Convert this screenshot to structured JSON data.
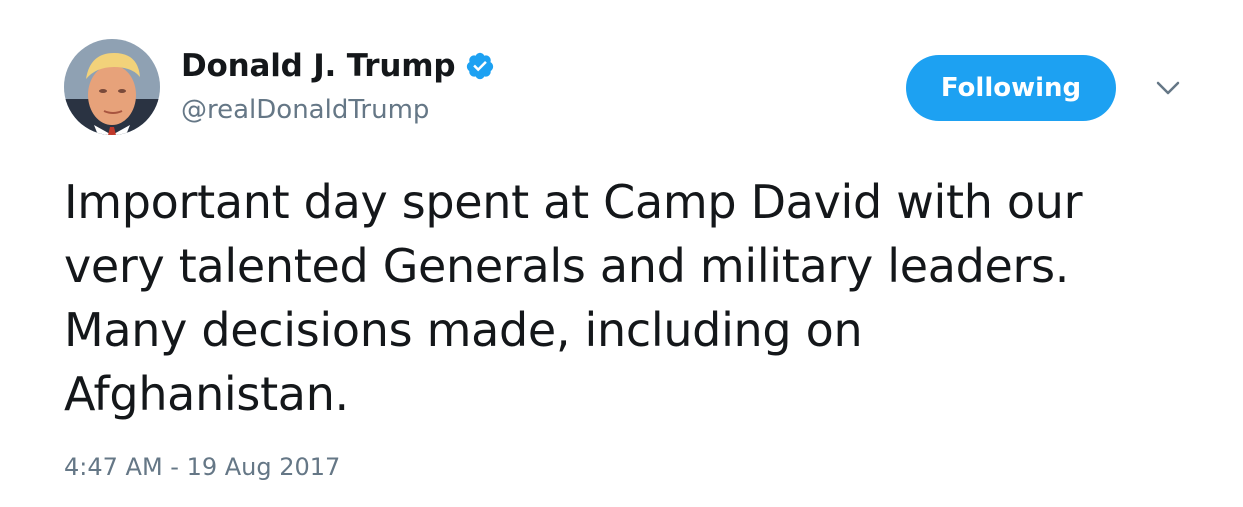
{
  "author": {
    "display_name": "Donald J. Trump",
    "handle": "@realDonaldTrump",
    "verified": true,
    "avatar_icon": "profile-photo"
  },
  "actions": {
    "follow_label": "Following",
    "more_icon": "chevron-down-icon"
  },
  "tweet": {
    "text": "Important day spent at Camp David with our\nvery talented Generals and military leaders.\nMany decisions made, including on\nAfghanistan.",
    "timestamp": "4:47 AM - 19 Aug 2017"
  },
  "colors": {
    "accent": "#1da1f2",
    "text_primary": "#14171a",
    "text_secondary": "#657786",
    "background": "#ffffff"
  }
}
